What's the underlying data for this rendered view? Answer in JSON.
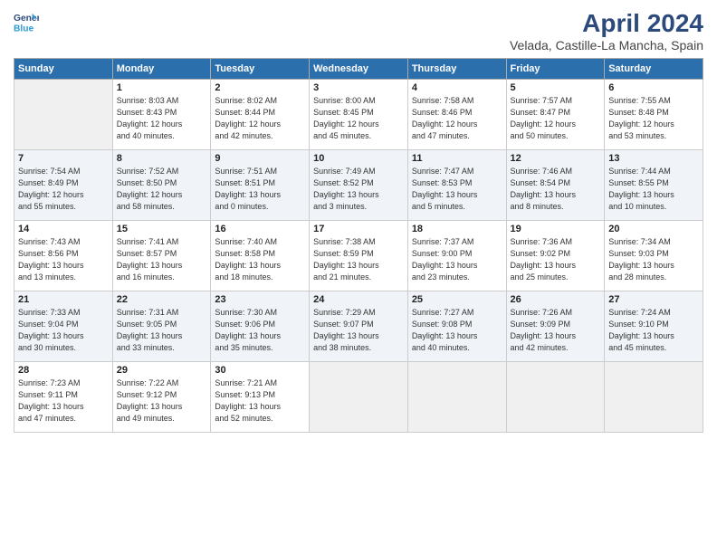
{
  "header": {
    "logo_line1": "General",
    "logo_line2": "Blue",
    "title": "April 2024",
    "subtitle": "Velada, Castille-La Mancha, Spain"
  },
  "days_of_week": [
    "Sunday",
    "Monday",
    "Tuesday",
    "Wednesday",
    "Thursday",
    "Friday",
    "Saturday"
  ],
  "weeks": [
    [
      {
        "day": "",
        "info": ""
      },
      {
        "day": "1",
        "info": "Sunrise: 8:03 AM\nSunset: 8:43 PM\nDaylight: 12 hours\nand 40 minutes."
      },
      {
        "day": "2",
        "info": "Sunrise: 8:02 AM\nSunset: 8:44 PM\nDaylight: 12 hours\nand 42 minutes."
      },
      {
        "day": "3",
        "info": "Sunrise: 8:00 AM\nSunset: 8:45 PM\nDaylight: 12 hours\nand 45 minutes."
      },
      {
        "day": "4",
        "info": "Sunrise: 7:58 AM\nSunset: 8:46 PM\nDaylight: 12 hours\nand 47 minutes."
      },
      {
        "day": "5",
        "info": "Sunrise: 7:57 AM\nSunset: 8:47 PM\nDaylight: 12 hours\nand 50 minutes."
      },
      {
        "day": "6",
        "info": "Sunrise: 7:55 AM\nSunset: 8:48 PM\nDaylight: 12 hours\nand 53 minutes."
      }
    ],
    [
      {
        "day": "7",
        "info": "Sunrise: 7:54 AM\nSunset: 8:49 PM\nDaylight: 12 hours\nand 55 minutes."
      },
      {
        "day": "8",
        "info": "Sunrise: 7:52 AM\nSunset: 8:50 PM\nDaylight: 12 hours\nand 58 minutes."
      },
      {
        "day": "9",
        "info": "Sunrise: 7:51 AM\nSunset: 8:51 PM\nDaylight: 13 hours\nand 0 minutes."
      },
      {
        "day": "10",
        "info": "Sunrise: 7:49 AM\nSunset: 8:52 PM\nDaylight: 13 hours\nand 3 minutes."
      },
      {
        "day": "11",
        "info": "Sunrise: 7:47 AM\nSunset: 8:53 PM\nDaylight: 13 hours\nand 5 minutes."
      },
      {
        "day": "12",
        "info": "Sunrise: 7:46 AM\nSunset: 8:54 PM\nDaylight: 13 hours\nand 8 minutes."
      },
      {
        "day": "13",
        "info": "Sunrise: 7:44 AM\nSunset: 8:55 PM\nDaylight: 13 hours\nand 10 minutes."
      }
    ],
    [
      {
        "day": "14",
        "info": "Sunrise: 7:43 AM\nSunset: 8:56 PM\nDaylight: 13 hours\nand 13 minutes."
      },
      {
        "day": "15",
        "info": "Sunrise: 7:41 AM\nSunset: 8:57 PM\nDaylight: 13 hours\nand 16 minutes."
      },
      {
        "day": "16",
        "info": "Sunrise: 7:40 AM\nSunset: 8:58 PM\nDaylight: 13 hours\nand 18 minutes."
      },
      {
        "day": "17",
        "info": "Sunrise: 7:38 AM\nSunset: 8:59 PM\nDaylight: 13 hours\nand 21 minutes."
      },
      {
        "day": "18",
        "info": "Sunrise: 7:37 AM\nSunset: 9:00 PM\nDaylight: 13 hours\nand 23 minutes."
      },
      {
        "day": "19",
        "info": "Sunrise: 7:36 AM\nSunset: 9:02 PM\nDaylight: 13 hours\nand 25 minutes."
      },
      {
        "day": "20",
        "info": "Sunrise: 7:34 AM\nSunset: 9:03 PM\nDaylight: 13 hours\nand 28 minutes."
      }
    ],
    [
      {
        "day": "21",
        "info": "Sunrise: 7:33 AM\nSunset: 9:04 PM\nDaylight: 13 hours\nand 30 minutes."
      },
      {
        "day": "22",
        "info": "Sunrise: 7:31 AM\nSunset: 9:05 PM\nDaylight: 13 hours\nand 33 minutes."
      },
      {
        "day": "23",
        "info": "Sunrise: 7:30 AM\nSunset: 9:06 PM\nDaylight: 13 hours\nand 35 minutes."
      },
      {
        "day": "24",
        "info": "Sunrise: 7:29 AM\nSunset: 9:07 PM\nDaylight: 13 hours\nand 38 minutes."
      },
      {
        "day": "25",
        "info": "Sunrise: 7:27 AM\nSunset: 9:08 PM\nDaylight: 13 hours\nand 40 minutes."
      },
      {
        "day": "26",
        "info": "Sunrise: 7:26 AM\nSunset: 9:09 PM\nDaylight: 13 hours\nand 42 minutes."
      },
      {
        "day": "27",
        "info": "Sunrise: 7:24 AM\nSunset: 9:10 PM\nDaylight: 13 hours\nand 45 minutes."
      }
    ],
    [
      {
        "day": "28",
        "info": "Sunrise: 7:23 AM\nSunset: 9:11 PM\nDaylight: 13 hours\nand 47 minutes."
      },
      {
        "day": "29",
        "info": "Sunrise: 7:22 AM\nSunset: 9:12 PM\nDaylight: 13 hours\nand 49 minutes."
      },
      {
        "day": "30",
        "info": "Sunrise: 7:21 AM\nSunset: 9:13 PM\nDaylight: 13 hours\nand 52 minutes."
      },
      {
        "day": "",
        "info": ""
      },
      {
        "day": "",
        "info": ""
      },
      {
        "day": "",
        "info": ""
      },
      {
        "day": "",
        "info": ""
      }
    ]
  ]
}
